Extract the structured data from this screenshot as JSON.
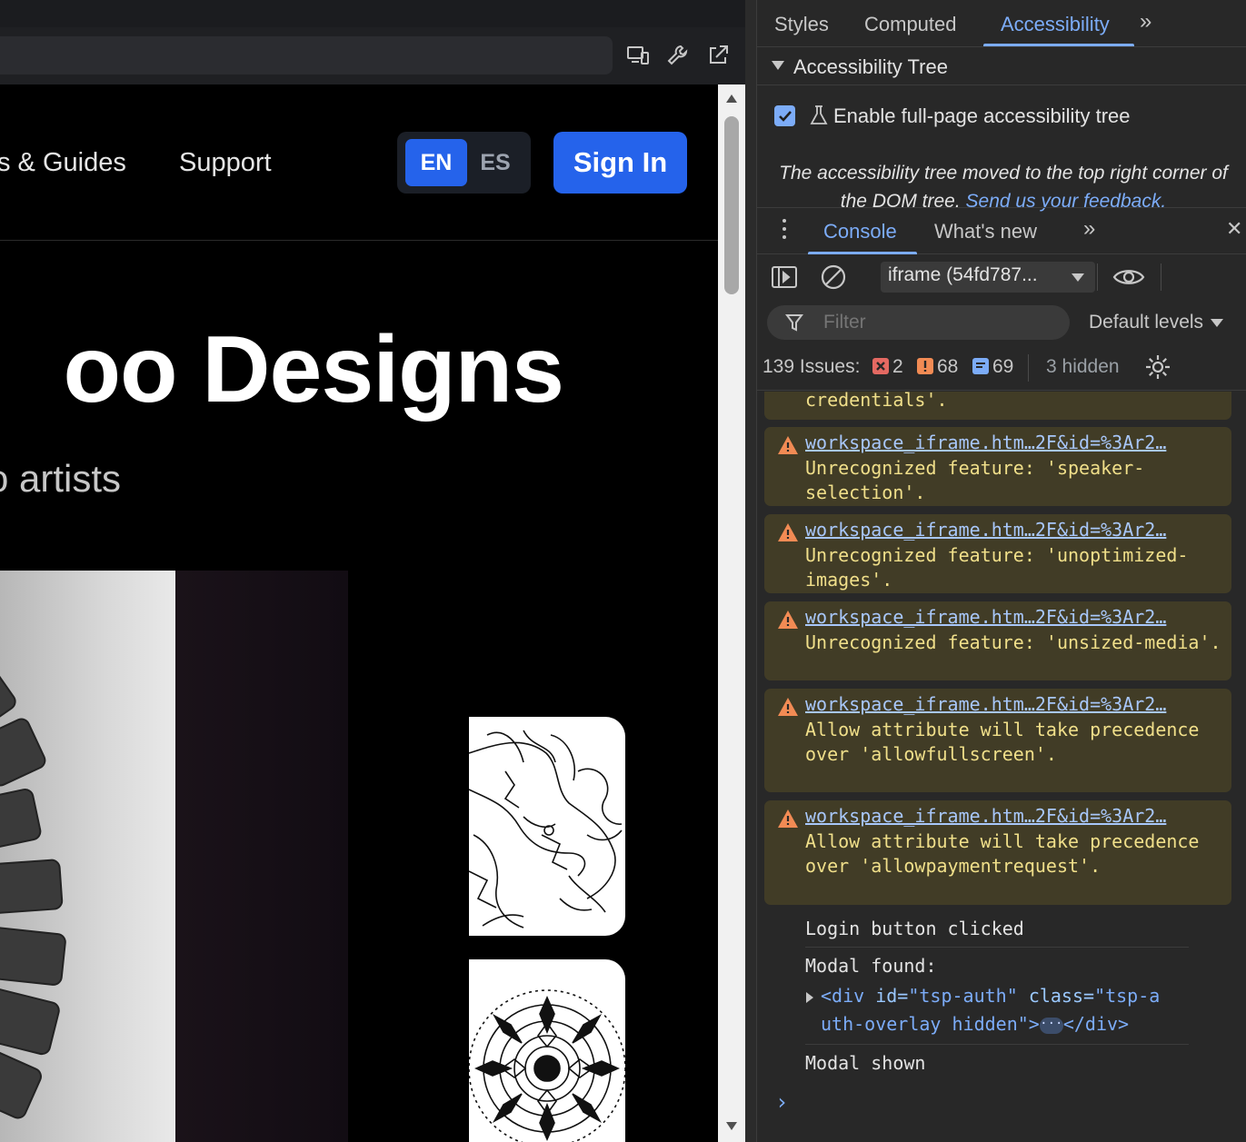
{
  "site": {
    "nav": {
      "guides_link": "s & Guides",
      "support_link": "Support",
      "lang_en": "EN",
      "lang_es": "ES",
      "sign_in": "Sign In"
    },
    "hero": {
      "title": "oo Designs",
      "subtitle": "o artists"
    }
  },
  "devtools": {
    "panel_tabs": {
      "styles": "Styles",
      "computed": "Computed",
      "accessibility": "Accessibility",
      "more": "»"
    },
    "accessibility": {
      "section_title": "Accessibility Tree",
      "enable_label": "Enable full-page accessibility tree",
      "enable_checked": true,
      "moved_notice": "The accessibility tree moved to the top right corner of the DOM tree.",
      "feedback_link": "Send us your feedback."
    },
    "drawer_tabs": {
      "console": "Console",
      "whats_new": "What's new",
      "more": "»",
      "close": "✕"
    },
    "toolbar": {
      "context": "iframe (54fd787...",
      "filter_placeholder": "Filter",
      "levels": "Default levels"
    },
    "issues": {
      "label": "139 Issues:",
      "errors": "2",
      "warnings": "68",
      "info": "69",
      "hidden": "3 hidden"
    },
    "messages": [
      {
        "type": "warning-tail",
        "text": "credentials'."
      },
      {
        "type": "warning",
        "source": "workspace_iframe.htm…2F&id=%3Ar2…",
        "text": "Unrecognized feature: 'speaker-selection'."
      },
      {
        "type": "warning",
        "source": "workspace_iframe.htm…2F&id=%3Ar2…",
        "text": "Unrecognized feature: 'unoptimized-images'."
      },
      {
        "type": "warning",
        "source": "workspace_iframe.htm…2F&id=%3Ar2…",
        "text": "Unrecognized feature: 'unsized-media'."
      },
      {
        "type": "warning",
        "source": "workspace_iframe.htm…2F&id=%3Ar2…",
        "text": "Allow attribute will take precedence over 'allowfullscreen'."
      },
      {
        "type": "warning",
        "source": "workspace_iframe.htm…2F&id=%3Ar2…",
        "text": "Allow attribute will take precedence over 'allowpaymentrequest'."
      },
      {
        "type": "log",
        "text": "Login button clicked"
      },
      {
        "type": "log",
        "text": "Modal found:"
      },
      {
        "type": "log",
        "text": "Modal shown"
      }
    ],
    "dom_node": {
      "open_tag": "<div",
      "attr1_name": "id=",
      "attr1_value": "\"tsp-auth\"",
      "attr2_name": "class=",
      "attr2_value_a": "\"tsp-a",
      "attr2_value_b": "uth-overlay hidden\"",
      "close_open": ">",
      "ellipsis": "···",
      "close_tag": "</div>"
    },
    "prompt": "›"
  },
  "colors": {
    "accent_blue": "#2563eb",
    "devtools_link": "#7cacf8",
    "warning_bg": "#413c26",
    "warning_text": "#f0df8a",
    "error_badge": "#e46962",
    "warning_badge": "#f28b54",
    "info_badge": "#7cacf8"
  }
}
